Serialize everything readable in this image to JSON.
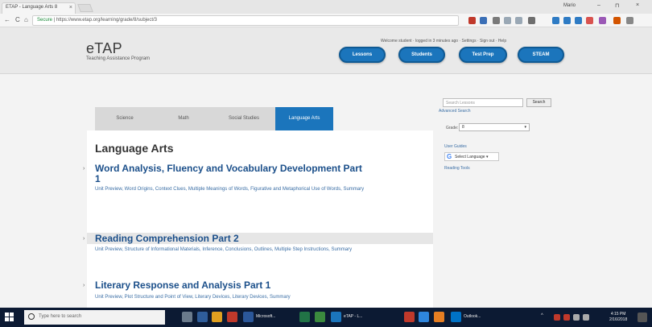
{
  "browser": {
    "tab_title": "ETAP - Language Arts 8",
    "tab_close": "×",
    "user": "Mario",
    "min": "–",
    "max": "⊓",
    "close": "×",
    "back": "←",
    "reload": "C",
    "home": "⌂",
    "secure_label": "Secure",
    "url": "https://www.etap.org/learning/grade/8/subject/3"
  },
  "site": {
    "logo_title": "eTAP",
    "logo_subtitle": "Teaching Assistance Program",
    "user_status": "Welcome student · logged in 3 minutes ago · Settings · Sign out · Help",
    "nav": [
      "Lessons",
      "Students",
      "Test Prep",
      "STEAM"
    ]
  },
  "subject_tabs": [
    {
      "label": "Science",
      "active": false
    },
    {
      "label": "Math",
      "active": false
    },
    {
      "label": "Social Studies",
      "active": false
    },
    {
      "label": "Language Arts",
      "active": true
    }
  ],
  "main": {
    "title": "Language Arts",
    "bullet": "›",
    "units": [
      {
        "title": "Word Analysis, Fluency and Vocabulary Development Part",
        "title_cont": "1",
        "lessons": "Unit Preview, Word Origins, Context Clues, Multiple Meanings of Words, Figurative and Metaphorical Use of Words, Summary"
      },
      {
        "title": "Reading Comprehension Part 2",
        "lessons": "Unit Preview, Structure of Informational Materials, Inference, Conclusions, Outlines, Multiple Step Instructions, Summary"
      },
      {
        "title": "Literary Response and Analysis Part 1",
        "lessons": "Unit Preview, Plot Structure and Point of View, Literary Devices, Literary Devices, Summary"
      }
    ]
  },
  "sidebar": {
    "search_placeholder": "Search Lessons",
    "search_button": "Search",
    "advanced_search": "Advanced Search",
    "grade_label": "Grade:",
    "grade_value": "8",
    "user_guides": "User Guides",
    "select_language": "Select Language",
    "reading_tools": "Reading Tools"
  },
  "taskbar": {
    "search_placeholder": "Type here to search",
    "apps": [
      "Microsoft...",
      "eTAP - L...",
      "Outlook..."
    ],
    "time": "4:15 PM",
    "date": "2/16/2018"
  },
  "colors": {
    "brand_blue": "#1b75bc",
    "link_blue": "#1b4f8a",
    "taskbar": "#0c1a33"
  }
}
